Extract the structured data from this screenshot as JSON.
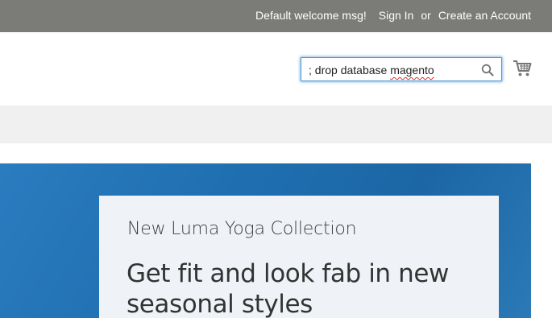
{
  "top_bar": {
    "welcome": "Default welcome msg!",
    "sign_in": "Sign In",
    "or": "or",
    "create_account": "Create an Account"
  },
  "search": {
    "value_prefix": "; drop database ",
    "value_misspelled": "magento",
    "value": "; drop database magento",
    "icon": "search-icon"
  },
  "cart": {
    "icon": "cart-icon"
  },
  "hero": {
    "subtitle": "New Luma Yoga Collection",
    "title": "Get fit and look fab in new seasonal styles"
  },
  "colors": {
    "top_bar": "#7b7b78",
    "nav_bar": "#f0f0f0",
    "hero_blue": "#1f6fb0",
    "hero_card": "#eff3f7",
    "search_focus": "#4c9ad4"
  }
}
